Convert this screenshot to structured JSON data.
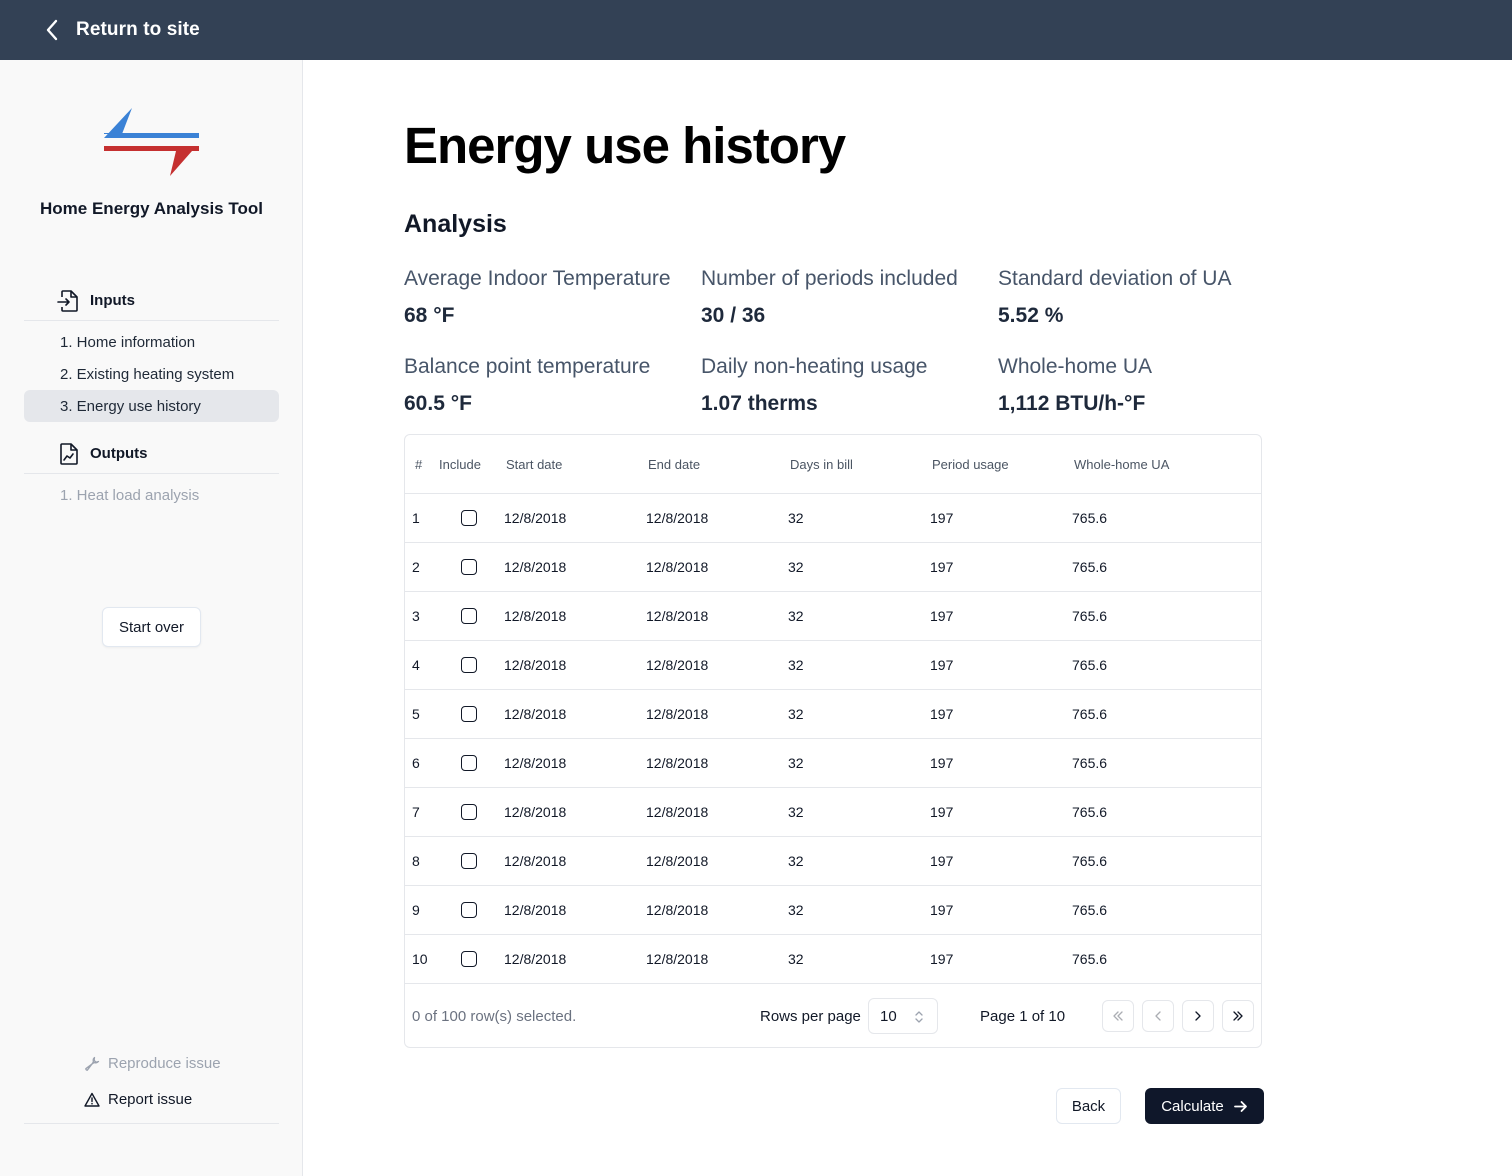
{
  "topbar": {
    "back_label": "Return to site"
  },
  "sidebar": {
    "app_title": "Home Energy Analysis Tool",
    "inputs_label": "Inputs",
    "input_items": [
      "1. Home information",
      "2. Existing heating system",
      "3. Energy use history"
    ],
    "outputs_label": "Outputs",
    "output_items": [
      "1. Heat load analysis"
    ],
    "start_over": "Start over",
    "reproduce_issue": "Reproduce issue",
    "report_issue": "Report issue"
  },
  "main": {
    "title": "Energy use history",
    "analysis_title": "Analysis",
    "stats": [
      {
        "label": "Average Indoor Temperature",
        "value": "68 °F"
      },
      {
        "label": "Number of periods included",
        "value": "30 / 36"
      },
      {
        "label": "Standard deviation of UA",
        "value": "5.52 %"
      },
      {
        "label": "Balance point temperature",
        "value": "60.5 °F"
      },
      {
        "label": "Daily non-heating usage",
        "value": "1.07 therms"
      },
      {
        "label": "Whole-home UA",
        "value": "1,112 BTU/h-°F"
      }
    ]
  },
  "table": {
    "headers": [
      "#",
      "Include",
      "Start date",
      "End date",
      "Days in bill",
      "Period usage",
      "Whole-home UA"
    ],
    "rows": [
      {
        "num": "1",
        "included": false,
        "start": "12/8/2018",
        "end": "12/8/2018",
        "days": "32",
        "usage": "197",
        "ua": "765.6"
      },
      {
        "num": "2",
        "included": false,
        "start": "12/8/2018",
        "end": "12/8/2018",
        "days": "32",
        "usage": "197",
        "ua": "765.6"
      },
      {
        "num": "3",
        "included": false,
        "start": "12/8/2018",
        "end": "12/8/2018",
        "days": "32",
        "usage": "197",
        "ua": "765.6"
      },
      {
        "num": "4",
        "included": false,
        "start": "12/8/2018",
        "end": "12/8/2018",
        "days": "32",
        "usage": "197",
        "ua": "765.6"
      },
      {
        "num": "5",
        "included": false,
        "start": "12/8/2018",
        "end": "12/8/2018",
        "days": "32",
        "usage": "197",
        "ua": "765.6"
      },
      {
        "num": "6",
        "included": false,
        "start": "12/8/2018",
        "end": "12/8/2018",
        "days": "32",
        "usage": "197",
        "ua": "765.6"
      },
      {
        "num": "7",
        "included": false,
        "start": "12/8/2018",
        "end": "12/8/2018",
        "days": "32",
        "usage": "197",
        "ua": "765.6"
      },
      {
        "num": "8",
        "included": false,
        "start": "12/8/2018",
        "end": "12/8/2018",
        "days": "32",
        "usage": "197",
        "ua": "765.6"
      },
      {
        "num": "9",
        "included": false,
        "start": "12/8/2018",
        "end": "12/8/2018",
        "days": "32",
        "usage": "197",
        "ua": "765.6"
      },
      {
        "num": "10",
        "included": false,
        "start": "12/8/2018",
        "end": "12/8/2018",
        "days": "32",
        "usage": "197",
        "ua": "765.6"
      }
    ]
  },
  "pagination": {
    "selected_text": "0 of 100 row(s) selected.",
    "rows_per_page_label": "Rows per page",
    "rows_per_page_value": "10",
    "page_text": "Page 1 of 10"
  },
  "actions": {
    "back": "Back",
    "calculate": "Calculate"
  },
  "icons": {
    "back": "chevron-left-icon",
    "inputs": "file-input-icon",
    "outputs": "file-chart-icon",
    "reproduce": "wrench-icon",
    "report": "warning-triangle-icon",
    "calculate": "arrow-right-icon"
  },
  "colors": {
    "topbar": "#334155",
    "sidebar": "#f9f9f9",
    "logo_blue": "#3b82d6",
    "logo_red": "#c53030",
    "primary_button": "#0f172a"
  }
}
